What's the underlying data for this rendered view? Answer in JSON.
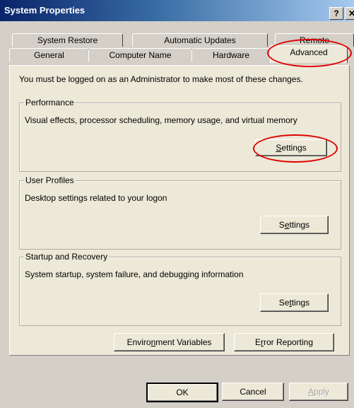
{
  "window": {
    "title": "System Properties",
    "help_label": "?",
    "close_label": "✕"
  },
  "tabs": {
    "row1": [
      {
        "label": "System Restore"
      },
      {
        "label": "Automatic Updates"
      },
      {
        "label": "Remote"
      }
    ],
    "row2": [
      {
        "label": "General"
      },
      {
        "label": "Computer Name"
      },
      {
        "label": "Hardware"
      },
      {
        "label": "Advanced"
      }
    ],
    "active": "Advanced"
  },
  "panel": {
    "admin_notice": "You must be logged on as an Administrator to make most of these changes."
  },
  "groups": {
    "performance": {
      "title": "Performance",
      "description": "Visual effects, processor scheduling, memory usage, and virtual memory",
      "button_pre": "",
      "button_hot": "S",
      "button_post": "ettings"
    },
    "user_profiles": {
      "title": "User Profiles",
      "description": "Desktop settings related to your logon",
      "button_pre": "S",
      "button_hot": "e",
      "button_post": "ttings"
    },
    "startup_recovery": {
      "title": "Startup and Recovery",
      "description": "System startup, system failure, and debugging information",
      "button_pre": "Se",
      "button_hot": "t",
      "button_post": "tings"
    }
  },
  "extra_buttons": {
    "env_pre": "Enviro",
    "env_hot": "n",
    "env_post": "ment Variables",
    "err_pre": "E",
    "err_hot": "r",
    "err_post": "ror Reporting"
  },
  "footer": {
    "ok_label": "OK",
    "cancel_label": "Cancel",
    "apply_pre": "",
    "apply_hot": "A",
    "apply_post": "pply"
  },
  "colors": {
    "annotation": "#e00000",
    "title_bar": "#0a246a",
    "dialog_bg": "#d4d0c8",
    "panel_bg": "#ece9d8"
  }
}
